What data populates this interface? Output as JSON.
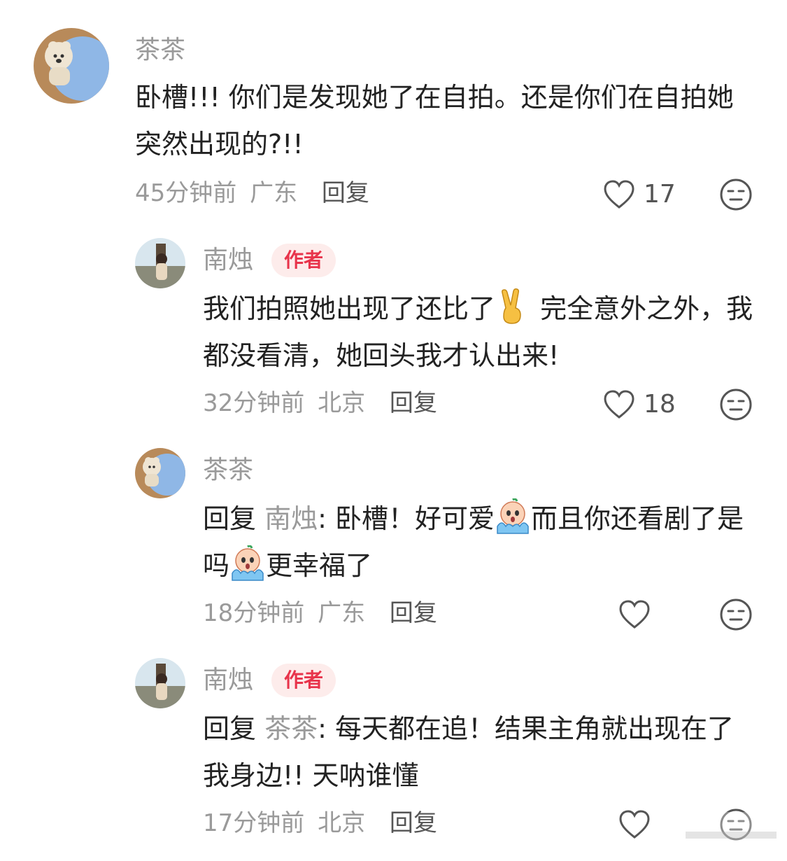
{
  "comments": [
    {
      "name": "茶茶",
      "is_author": false,
      "text_parts": [
        "卧槽!!! 你们是发现她了在自拍。还是你们在自拍她突然出现的?!!"
      ],
      "time": "45分钟前",
      "location": "广东",
      "reply_label": "回复",
      "likes": "17"
    },
    {
      "name": "南烛",
      "is_author": true,
      "badge": "作者",
      "text_before": "我们拍照她出现了还比了",
      "emoji": "victory-hand",
      "text_after": " 完全意外之外，我都没看清，她回头我才认出来!",
      "time": "32分钟前",
      "location": "北京",
      "reply_label": "回复",
      "likes": "18"
    },
    {
      "name": "茶茶",
      "is_author": false,
      "reply_prefix": "回复",
      "reply_target": "南烛",
      "text_a": ": 卧槽！好可爱",
      "text_b": "而且你还看剧了是吗",
      "text_c": "更幸福了",
      "emoji": "crying-face",
      "time": "18分钟前",
      "location": "广东",
      "reply_label": "回复",
      "likes": ""
    },
    {
      "name": "南烛",
      "is_author": true,
      "badge": "作者",
      "reply_prefix": "回复",
      "reply_target": "茶茶",
      "text": ": 每天都在追！结果主角就出现在了我身边!! 天呐谁懂",
      "time": "17分钟前",
      "location": "北京",
      "reply_label": "回复",
      "likes": ""
    }
  ],
  "icons": {
    "like": "heart-outline-icon",
    "dislike": "neutral-face-icon"
  },
  "colors": {
    "author_badge_bg": "#fdeceb",
    "author_badge_text": "#e8344b",
    "muted": "#9a9a9a"
  }
}
